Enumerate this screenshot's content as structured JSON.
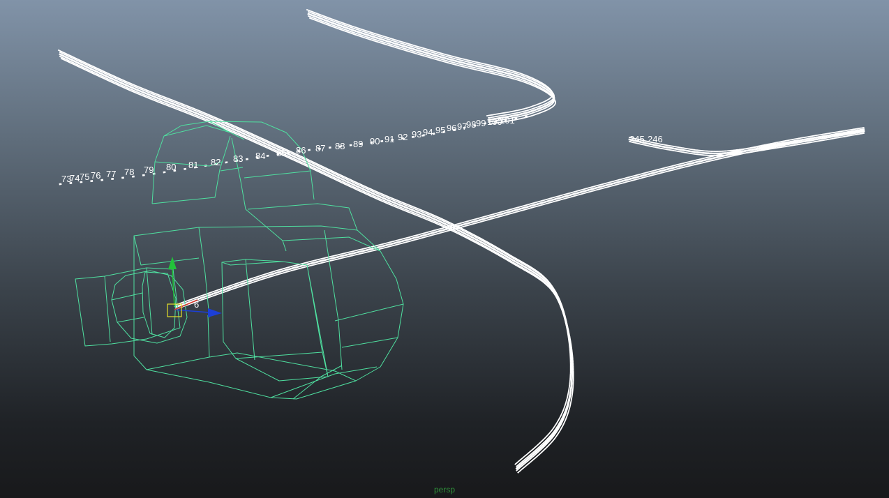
{
  "viewport": {
    "camera_name": "persp"
  },
  "colors": {
    "background_top": "#8193a8",
    "background_bottom": "#18191b",
    "wireframe": "#4fe0a0",
    "motion_trail": "#ffffff",
    "frame_number": "#ffffff",
    "camera_label": "#2f8f3a",
    "manipulator_y": "#22c33a",
    "manipulator_z": "#1c3fd6",
    "manipulator_center": "#e4e02a"
  },
  "icons": [
    "move-manipulator-icon"
  ],
  "frame_labels": {
    "upper_row": [
      "73",
      "74",
      "75",
      "76",
      "77",
      "78",
      "79",
      "80",
      "81",
      "82",
      "83",
      "84",
      "85",
      "86",
      "87",
      "88",
      "89",
      "90",
      "91",
      "92",
      "93",
      "94",
      "95",
      "96",
      "97",
      "98",
      "99",
      "100",
      "101"
    ],
    "right_end": [
      "245",
      "246"
    ],
    "lower_start": [
      "6"
    ]
  }
}
